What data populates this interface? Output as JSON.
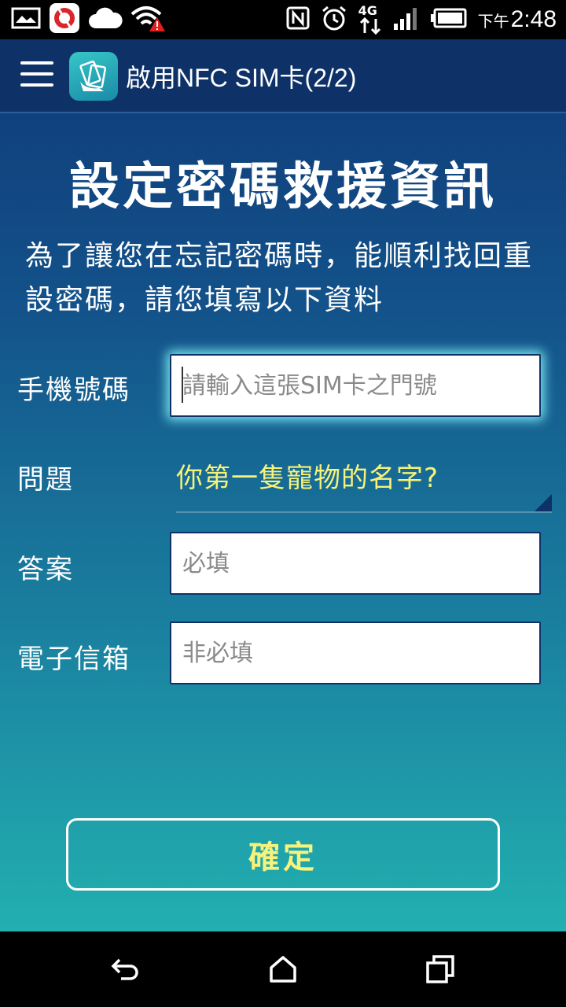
{
  "status_bar": {
    "time_prefix": "下午",
    "time": "2:48",
    "network_label": "4G",
    "icons": [
      "notification-image-icon",
      "app-notification-icon",
      "cloud-icon",
      "wifi-warning-icon",
      "nfc-icon",
      "alarm-icon",
      "mobile-data-icon",
      "signal-icon",
      "battery-icon"
    ]
  },
  "action_bar": {
    "title": "啟用NFC SIM卡(2/2)",
    "icons": [
      "menu-icon",
      "app-logo-icon"
    ]
  },
  "main": {
    "title": "設定密碼救援資訊",
    "description": "為了讓您在忘記密碼時，能順利找回重設密碼，請您填寫以下資料"
  },
  "form": {
    "phone": {
      "label": "手機號碼",
      "placeholder": "請輸入這張SIM卡之門號",
      "value": ""
    },
    "question": {
      "label": "問題",
      "selected": "你第一隻寵物的名字?"
    },
    "answer": {
      "label": "答案",
      "placeholder": "必填",
      "value": ""
    },
    "email": {
      "label": "電子信箱",
      "placeholder": "非必填",
      "value": ""
    }
  },
  "confirm_button": {
    "label": "確定"
  },
  "colors": {
    "accent_yellow": "#f6f27a",
    "header_blue": "#0e3268",
    "gradient_bottom": "#22b0b0"
  },
  "nav_bar": {
    "icons": [
      "back-icon",
      "home-icon",
      "recents-icon"
    ]
  }
}
